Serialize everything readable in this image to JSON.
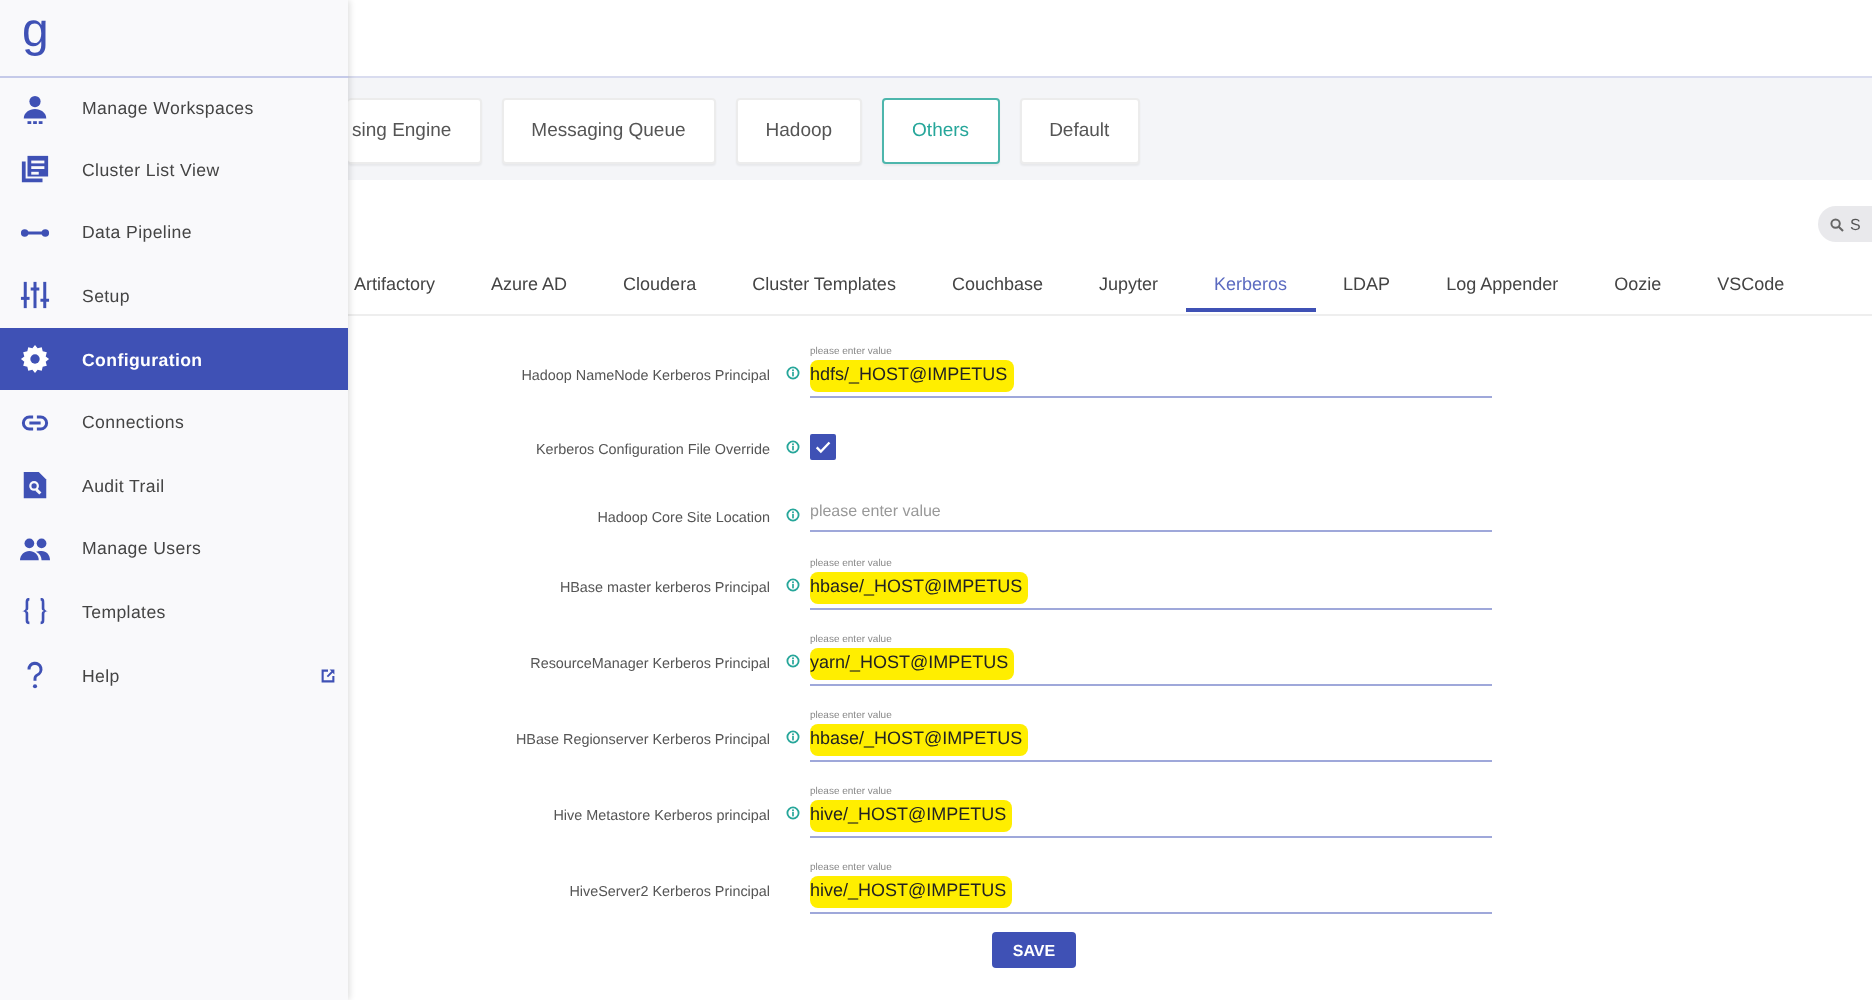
{
  "sidebar": {
    "logo": "g",
    "items": [
      {
        "label": "Manage Workspaces",
        "selected": false,
        "external": false
      },
      {
        "label": "Cluster List View",
        "selected": false,
        "external": false
      },
      {
        "label": "Data Pipeline",
        "selected": false,
        "external": false
      },
      {
        "label": "Setup",
        "selected": false,
        "external": false
      },
      {
        "label": "Configuration",
        "selected": true,
        "external": false
      },
      {
        "label": "Connections",
        "selected": false,
        "external": false
      },
      {
        "label": "Audit Trail",
        "selected": false,
        "external": false
      },
      {
        "label": "Manage Users",
        "selected": false,
        "external": false
      },
      {
        "label": "Templates",
        "selected": false,
        "external": false
      },
      {
        "label": "Help",
        "selected": false,
        "external": true
      }
    ]
  },
  "category_tabs": [
    {
      "label": "sing Engine",
      "selected": false
    },
    {
      "label": "Messaging Queue",
      "selected": false
    },
    {
      "label": "Hadoop",
      "selected": false
    },
    {
      "label": "Others",
      "selected": true
    },
    {
      "label": "Default",
      "selected": false
    }
  ],
  "search": {
    "placeholder": "S"
  },
  "sub_tabs": [
    {
      "label": "Artifactory",
      "selected": false
    },
    {
      "label": "Azure AD",
      "selected": false
    },
    {
      "label": "Cloudera",
      "selected": false
    },
    {
      "label": "Cluster Templates",
      "selected": false
    },
    {
      "label": "Couchbase",
      "selected": false
    },
    {
      "label": "Jupyter",
      "selected": false
    },
    {
      "label": "Kerberos",
      "selected": true
    },
    {
      "label": "LDAP",
      "selected": false
    },
    {
      "label": "Log Appender",
      "selected": false
    },
    {
      "label": "Oozie",
      "selected": false
    },
    {
      "label": "VSCode",
      "selected": false
    }
  ],
  "form": {
    "fields": [
      {
        "kind": "text",
        "label": "Hadoop NameNode Kerberos Principal",
        "info": true,
        "floating_label": "please enter value",
        "value": "hdfs/_HOST@IMPETUS",
        "highlighted": true
      },
      {
        "kind": "checkbox",
        "label": "Kerberos Configuration File Override",
        "info": true,
        "checked": true
      },
      {
        "kind": "text",
        "label": "Hadoop Core Site Location",
        "info": true,
        "placeholder": "please enter value",
        "highlighted": false
      },
      {
        "kind": "text",
        "label": "HBase master kerberos Principal",
        "info": true,
        "floating_label": "please enter value",
        "value": "hbase/_HOST@IMPETUS",
        "highlighted": true
      },
      {
        "kind": "text",
        "label": "ResourceManager Kerberos Principal",
        "info": true,
        "floating_label": "please enter value",
        "value": "yarn/_HOST@IMPETUS",
        "highlighted": true
      },
      {
        "kind": "text",
        "label": "HBase Regionserver Kerberos Principal",
        "info": true,
        "floating_label": "please enter value",
        "value": "hbase/_HOST@IMPETUS",
        "highlighted": true
      },
      {
        "kind": "text",
        "label": "Hive Metastore Kerberos principal",
        "info": true,
        "floating_label": "please enter value",
        "value": "hive/_HOST@IMPETUS",
        "highlighted": true
      },
      {
        "kind": "text",
        "label": "HiveServer2 Kerberos Principal",
        "info": false,
        "floating_label": "please enter value",
        "value": "hive/_HOST@IMPETUS",
        "highlighted": true
      }
    ],
    "save_button": "SAVE"
  }
}
